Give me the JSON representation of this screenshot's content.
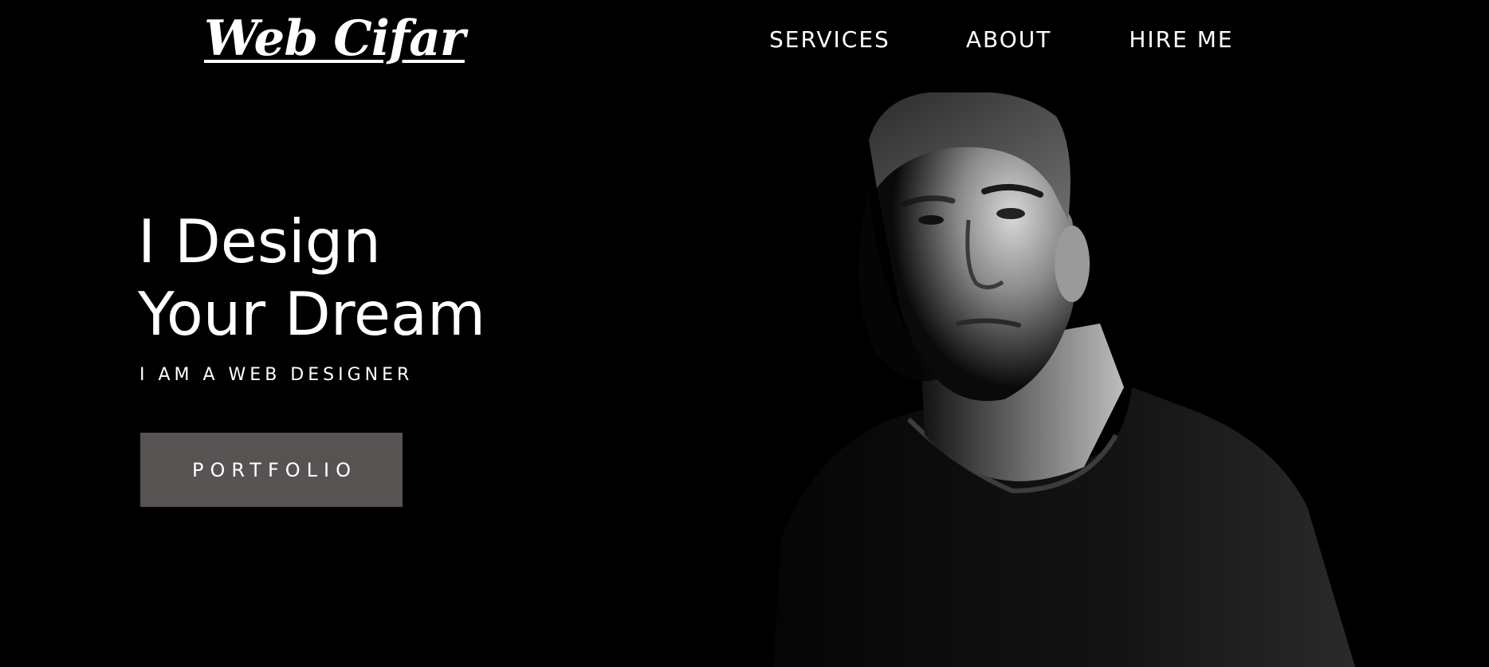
{
  "header": {
    "logo_text": "Web Cifar",
    "nav": {
      "services": "SERVICES",
      "about": "ABOUT",
      "hire_me": "HIRE ME"
    }
  },
  "hero": {
    "title_line1": "I Design",
    "title_line2": "Your Dream",
    "subtitle": "I AM A WEB DESIGNER",
    "cta_label": "PORTFOLIO",
    "cta_color": "#575352"
  },
  "portrait": {
    "image_semantic": "man-portrait-photo"
  },
  "colors": {
    "background": "#000000",
    "text": "#ffffff"
  }
}
